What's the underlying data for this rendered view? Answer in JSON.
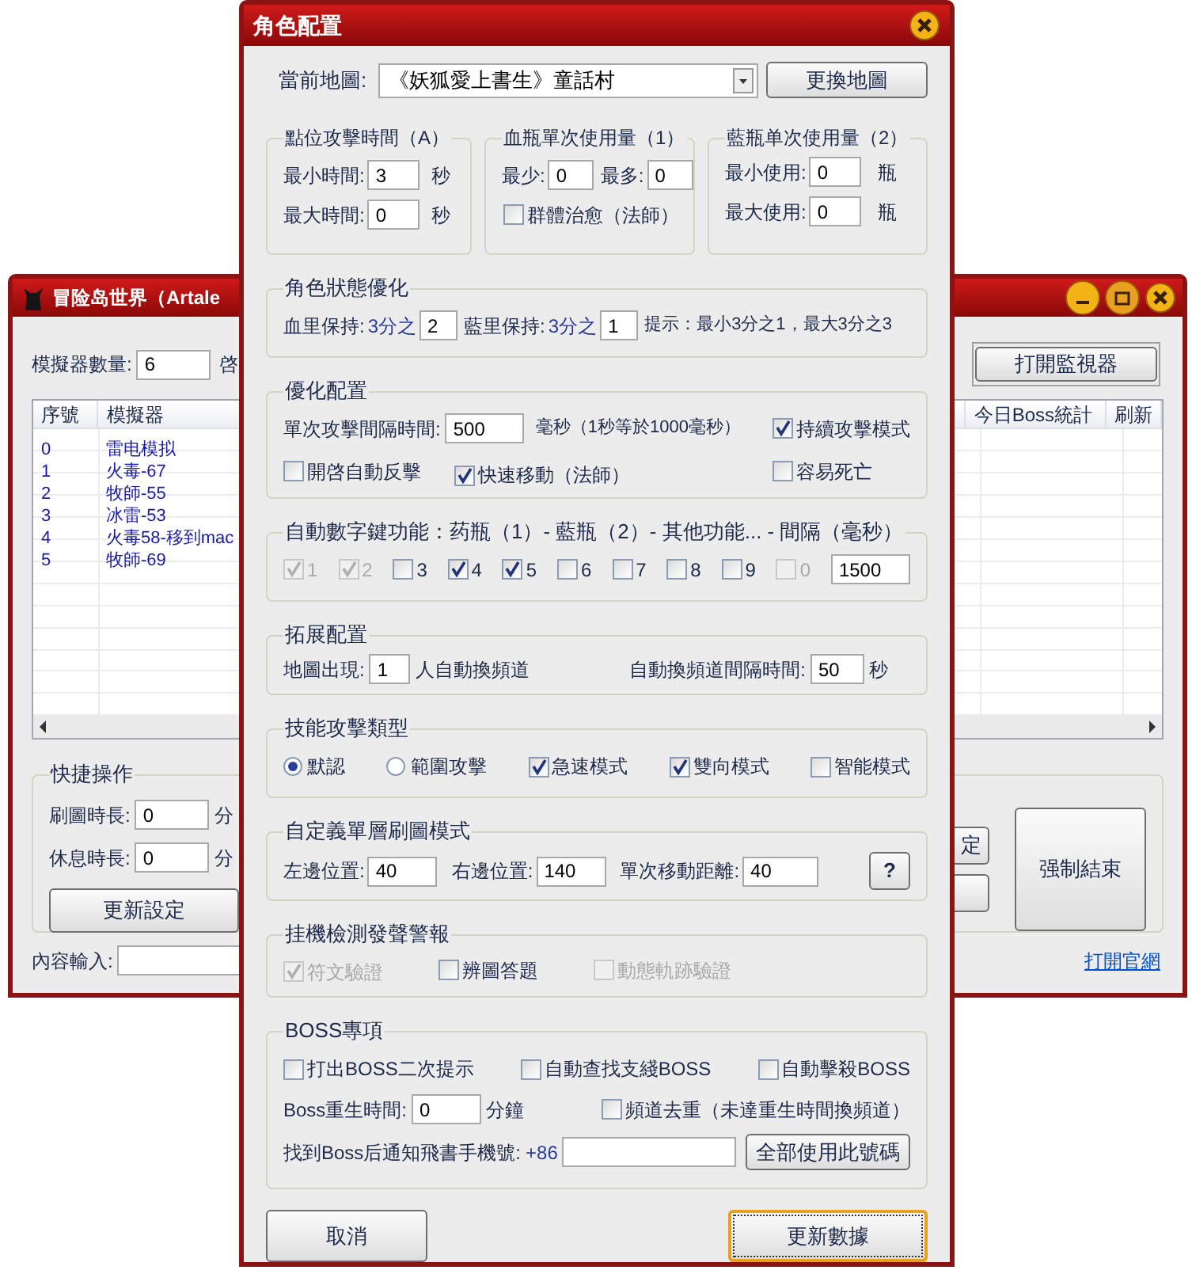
{
  "back_window": {
    "title": "冒险岛世界（Artale",
    "emulator_count_label": "模擬器數量:",
    "emulator_count": "6",
    "cut_label": "啓",
    "monitor_button": "打開監視器",
    "table": {
      "columns": [
        {
          "label": "序號"
        },
        {
          "label": "模擬器"
        },
        {
          "label": "今日Boss統計"
        },
        {
          "label": "刷新"
        }
      ],
      "rows": [
        {
          "index": "0",
          "emulator": "雷电模拟"
        },
        {
          "index": "1",
          "emulator": "火毒-67"
        },
        {
          "index": "2",
          "emulator": "牧師-55"
        },
        {
          "index": "3",
          "emulator": "冰雷-53"
        },
        {
          "index": "4",
          "emulator": "火毒58-移到mac"
        },
        {
          "index": "5",
          "emulator": "牧師-69"
        }
      ]
    },
    "quick_actions": {
      "title": "快捷操作",
      "fields": [
        {
          "label": "刷圖時長:",
          "value": "0",
          "unit": "分"
        },
        {
          "label": "休息時長:",
          "value": "0",
          "unit": "分"
        }
      ],
      "update_button": "更新設定",
      "partial_button": "定",
      "force_stop_button": "强制結束"
    },
    "content_input_label": "內容輸入:",
    "website_link": "打開官網"
  },
  "dialog": {
    "title": "角色配置",
    "map": {
      "label": "當前地圖:",
      "value": "《妖狐愛上書生》童話村",
      "button": "更換地圖"
    },
    "attack_time": {
      "title": "點位攻擊時間（A）",
      "rows": [
        {
          "label": "最小時間:",
          "value": "3",
          "unit": "秒"
        },
        {
          "label": "最大時間:",
          "value": "0",
          "unit": "秒"
        }
      ]
    },
    "hp_potion": {
      "title": "血瓶單次使用量（1）",
      "min_label": "最少:",
      "min": "0",
      "max_label": "最多:",
      "max": "0",
      "group_heal": {
        "label": "群體治愈（法師）",
        "checked": false
      }
    },
    "mp_potion": {
      "title": "藍瓶单次使用量（2）",
      "rows": [
        {
          "label": "最小使用:",
          "value": "0",
          "unit": "瓶"
        },
        {
          "label": "最大使用:",
          "value": "0",
          "unit": "瓶"
        }
      ]
    },
    "state": {
      "title": "角色狀態優化",
      "hp_label": "血里保持:",
      "hp_prefix": "3分之",
      "hp_value": "2",
      "mp_label": "藍里保持:",
      "mp_prefix": "3分之",
      "mp_value": "1",
      "hint": "提示：最小3分之1，最大3分之3"
    },
    "optimize": {
      "title": "優化配置",
      "interval_label": "單次攻擊間隔時間:",
      "interval": "500",
      "interval_unit": "毫秒（1秒等於1000毫秒）",
      "options": [
        {
          "label": "持續攻擊模式",
          "checked": true
        },
        {
          "label": "開啓自動反擊",
          "checked": false
        },
        {
          "label": "快速移動（法師）",
          "checked": true
        },
        {
          "label": "容易死亡",
          "checked": false
        }
      ]
    },
    "number_keys": {
      "title": "自動數字鍵功能：药瓶（1）- 藍瓶（2）- 其他功能... - 間隔（毫秒）",
      "keys": [
        {
          "label": "1",
          "checked": true,
          "disabled": true
        },
        {
          "label": "2",
          "checked": true,
          "disabled": true
        },
        {
          "label": "3",
          "checked": false,
          "disabled": false
        },
        {
          "label": "4",
          "checked": true,
          "disabled": false
        },
        {
          "label": "5",
          "checked": true,
          "disabled": false
        },
        {
          "label": "6",
          "checked": false,
          "disabled": false
        },
        {
          "label": "7",
          "checked": false,
          "disabled": false
        },
        {
          "label": "8",
          "checked": false,
          "disabled": false
        },
        {
          "label": "9",
          "checked": false,
          "disabled": false
        },
        {
          "label": "0",
          "checked": false,
          "disabled": true
        }
      ],
      "interval": "1500"
    },
    "extension": {
      "title": "拓展配置",
      "players_label": "地圖出現:",
      "players": "1",
      "players_unit": "人自動換頻道",
      "switch_label": "自動換頻道間隔時間:",
      "switch_value": "50",
      "switch_unit": "秒"
    },
    "skill_type": {
      "title": "技能攻擊類型",
      "options": [
        {
          "kind": "radio",
          "label": "默認",
          "selected": true
        },
        {
          "kind": "radio",
          "label": "範圍攻擊",
          "selected": false
        },
        {
          "kind": "checkbox",
          "label": "急速模式",
          "checked": true
        },
        {
          "kind": "checkbox",
          "label": "雙向模式",
          "checked": true
        },
        {
          "kind": "checkbox",
          "label": "智能模式",
          "checked": false
        }
      ]
    },
    "custom_map": {
      "title": "自定義單層刷圖模式",
      "fields": [
        {
          "label": "左邊位置:",
          "value": "40"
        },
        {
          "label": "右邊位置:",
          "value": "140"
        },
        {
          "label": "單次移動距離:",
          "value": "40"
        }
      ],
      "help_button": "?"
    },
    "afk_alert": {
      "title": "挂機檢測發聲警報",
      "options": [
        {
          "label": "符文驗證",
          "checked": true,
          "disabled": true
        },
        {
          "label": "辨圖答題",
          "checked": false,
          "disabled": false
        },
        {
          "label": "動態軌跡驗證",
          "checked": false,
          "disabled": true
        }
      ]
    },
    "boss": {
      "title": "BOSS專項",
      "options": [
        {
          "label": "打出BOSS二次提示",
          "checked": false
        },
        {
          "label": "自動查找支綫BOSS",
          "checked": false
        },
        {
          "label": "自動擊殺BOSS",
          "checked": false
        }
      ],
      "respawn_label": "Boss重生時間:",
      "respawn": "0",
      "respawn_unit": "分鐘",
      "dedupe": {
        "label": "頻道去重（未達重生時間換頻道）",
        "checked": false
      },
      "notify_label": "找到Boss后通知飛書手機號:",
      "notify_prefix": "+86",
      "notify_button": "全部使用此號碼"
    },
    "cancel_button": "取消",
    "submit_button": "更新數據"
  }
}
